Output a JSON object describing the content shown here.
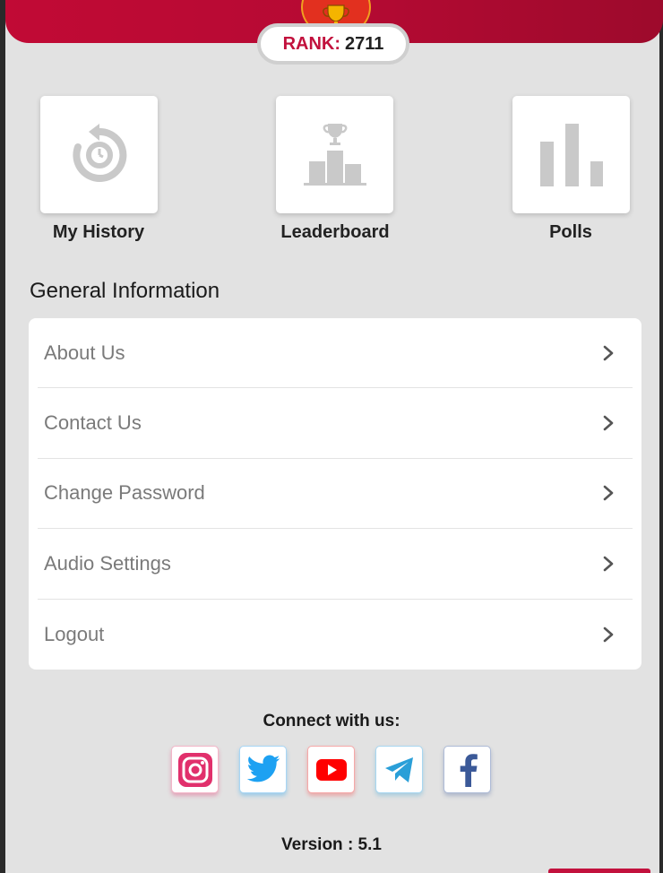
{
  "header": {
    "rank_label": "RANK:",
    "rank_value": "2711",
    "badge_icon": "trophy-icon"
  },
  "quick_actions": [
    {
      "label": "My History",
      "icon": "history-icon"
    },
    {
      "label": "Leaderboard",
      "icon": "podium-trophy-icon"
    },
    {
      "label": "Polls",
      "icon": "bar-chart-icon"
    }
  ],
  "general": {
    "title": "General Information",
    "items": [
      {
        "label": "About Us"
      },
      {
        "label": "Contact Us"
      },
      {
        "label": "Change Password"
      },
      {
        "label": "Audio Settings"
      },
      {
        "label": "Logout"
      }
    ]
  },
  "connect": {
    "title": "Connect with us:",
    "networks": [
      {
        "icon": "instagram-icon",
        "color": "#e1306c"
      },
      {
        "icon": "twitter-icon",
        "color": "#1da1f2"
      },
      {
        "icon": "youtube-icon",
        "color": "#ff0000"
      },
      {
        "icon": "telegram-icon",
        "color": "#2a9fd8"
      },
      {
        "icon": "facebook-icon",
        "color": "#3b5998"
      }
    ]
  },
  "version": "Version : 5.1",
  "colors": {
    "brand": "#c2113d",
    "background": "#e2e2e2",
    "icon_gray": "#c9c9c9"
  }
}
